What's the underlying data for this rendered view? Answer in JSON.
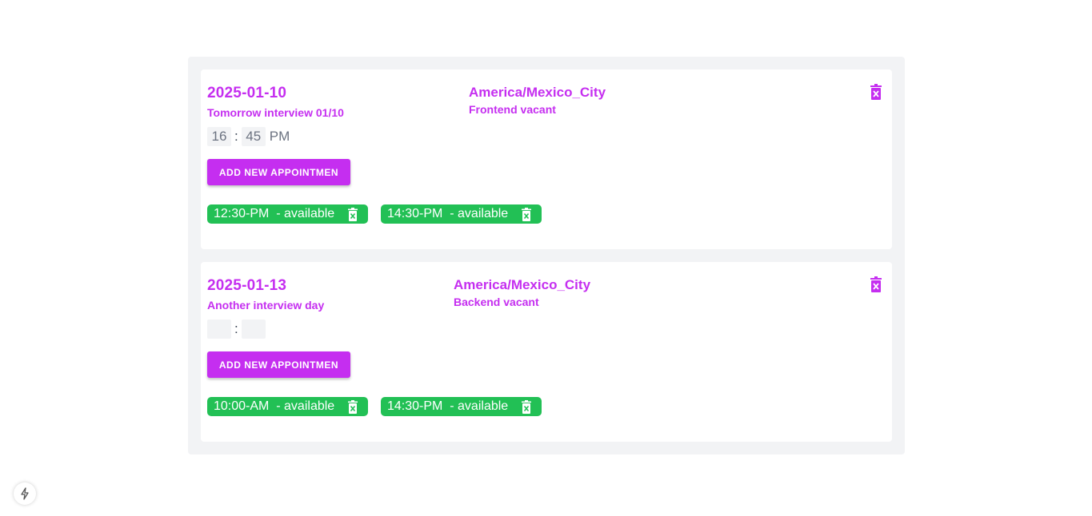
{
  "accent_color": "#c52ef0",
  "available_color": "#22c055",
  "days": [
    {
      "date": "2025-01-10",
      "title": "Tomorrow interview 01/10",
      "timezone": "America/Mexico_City",
      "vacant": "Frontend vacant",
      "time": {
        "hour": "16",
        "minute": "45",
        "ampm": "PM",
        "separator": ":"
      },
      "add_button": "ADD NEW APPOINTMEN",
      "slots": [
        {
          "label": "12:30-PM  - available"
        },
        {
          "label": "14:30-PM  - available"
        }
      ]
    },
    {
      "date": "2025-01-13",
      "title": "Another interview day",
      "timezone": "America/Mexico_City",
      "vacant": "Backend vacant",
      "time": {
        "hour": "",
        "minute": "",
        "ampm": "",
        "separator": ":"
      },
      "add_button": "ADD NEW APPOINTMEN",
      "slots": [
        {
          "label": "10:00-AM  - available"
        },
        {
          "label": "14:30-PM  - available"
        }
      ]
    }
  ],
  "icons": {
    "day_delete": "trash-x-icon",
    "slot_delete": "trash-x-icon",
    "dev_badge": "lightning-icon"
  }
}
